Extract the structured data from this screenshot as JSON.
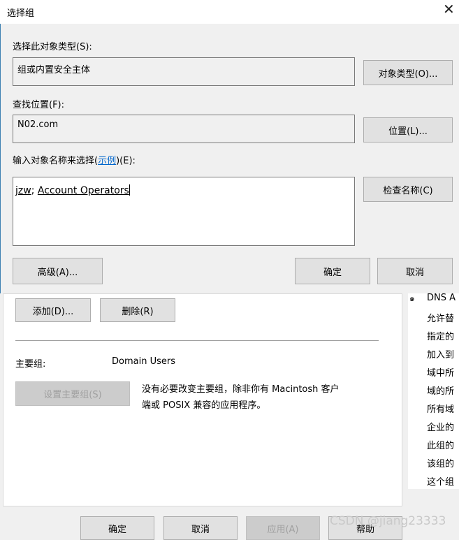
{
  "dialog": {
    "title": "选择组",
    "object_type_label": "选择此对象类型(S):",
    "object_type_value": "组或内置安全主体",
    "object_type_button": "对象类型(O)...",
    "location_label": "查找位置(F):",
    "location_value": "N02.com",
    "location_button": "位置(L)...",
    "names_label_prefix": "输入对象名称来选择(",
    "names_label_link": "示例",
    "names_label_suffix": ")(E):",
    "names_value_1": "jzw",
    "names_sep": "; ",
    "names_value_2": "Account Operators",
    "check_names_button": "检查名称(C)",
    "advanced_button": "高级(A)...",
    "ok_button": "确定",
    "cancel_button": "取消"
  },
  "background": {
    "add_button": "添加(D)...",
    "remove_button": "删除(R)",
    "primary_group_label": "主要组:",
    "primary_group_value": "Domain Users",
    "set_primary_button": "设置主要组(S)",
    "note_line1": "没有必要改变主要组，除非你有 Macintosh 客户",
    "note_line2": "端或 POSIX 兼容的应用程序。",
    "list_marker": "๑",
    "list_items": [
      "DNS A",
      "允许替",
      "指定的",
      "加入到",
      "域中所",
      "域的所",
      "所有域",
      "企业的",
      "此组的",
      "该组的",
      "这个组"
    ],
    "footer_ok": "确定",
    "footer_cancel": "取消",
    "footer_apply": "应用(A)",
    "footer_help": "帮助"
  },
  "watermark": "CSDN @jiang23333"
}
